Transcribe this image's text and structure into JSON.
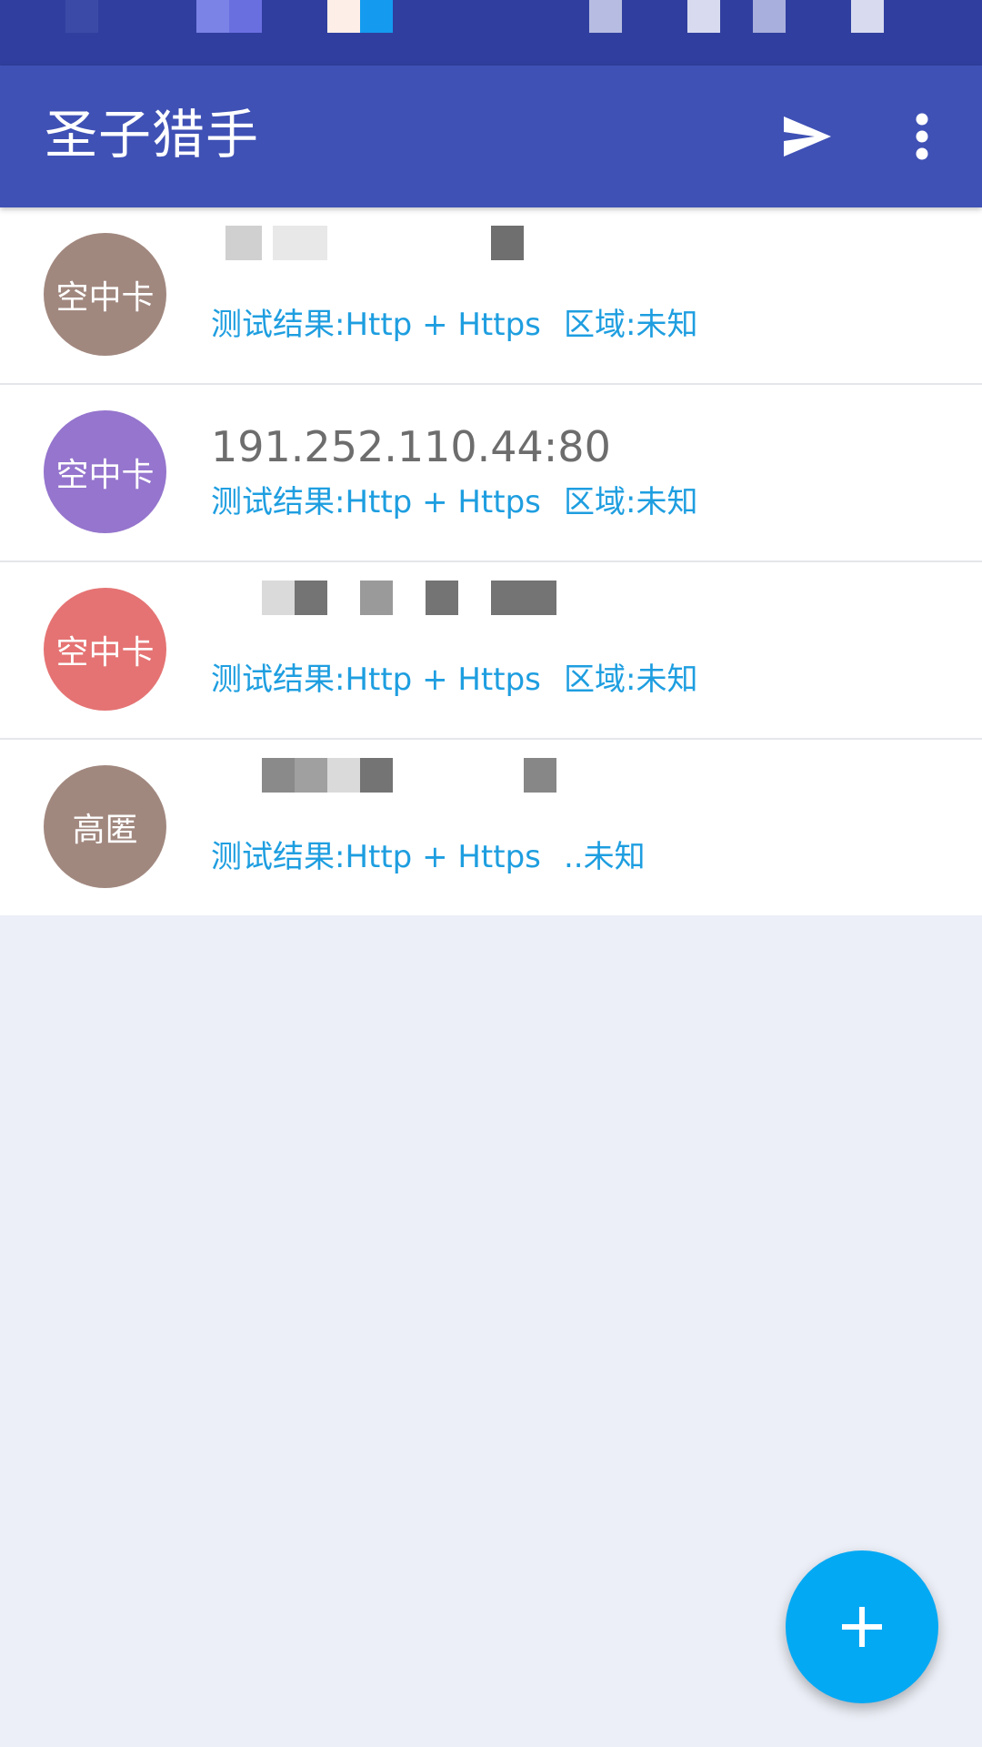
{
  "app_bar": {
    "title": "圣子猎手",
    "send_icon": "send-icon",
    "more_icon": "more-vert-icon"
  },
  "colors": {
    "status_bar": "#303f9f",
    "app_bar": "#3f51b5",
    "accent": "#04a9f4",
    "link_text": "#1e9ee0",
    "background": "#eceff7"
  },
  "proxies": [
    {
      "avatar_label": "空中卡",
      "avatar_color": "#a1887f",
      "address": "",
      "test_result": "测试结果:Http + Https",
      "region": "区域:未知"
    },
    {
      "avatar_label": "空中卡",
      "avatar_color": "#9575cd",
      "address": "191.252.110.44:80",
      "test_result": "测试结果:Http + Https",
      "region": "区域:未知"
    },
    {
      "avatar_label": "空中卡",
      "avatar_color": "#e57373",
      "address": "",
      "test_result": "测试结果:Http + Https",
      "region": "区域:未知"
    },
    {
      "avatar_label": "高匿",
      "avatar_color": "#a1887f",
      "address": "",
      "test_result": "测试结果:Http + Https",
      "region": "..未知"
    }
  ],
  "fab": {
    "icon": "add-icon"
  }
}
